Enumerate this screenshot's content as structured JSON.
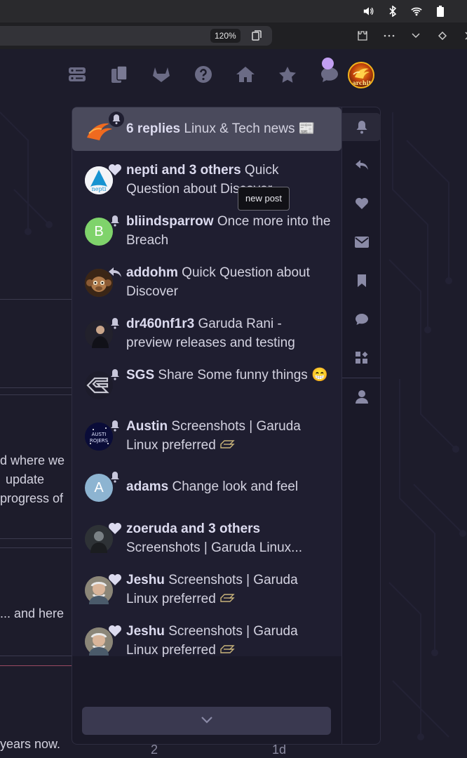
{
  "browser": {
    "zoom": "120%"
  },
  "header": {
    "icons": [
      "servers-icon",
      "documents-icon",
      "gitlab-icon",
      "help-icon",
      "home-icon",
      "star-icon",
      "chat-icon"
    ],
    "avatar_text": "archit"
  },
  "background": {
    "text1": "d where we",
    "text2": "update",
    "text3": "progress of",
    "text4": "... and here",
    "text5": "years now.",
    "text6": "2",
    "text7": "1d"
  },
  "tooltip": "new post",
  "notifications": [
    {
      "user": "6 replies",
      "topic": "Linux & Tech news 📰",
      "badge": "bell",
      "avatar": "archit",
      "active": true
    },
    {
      "user": "nepti and 3 others",
      "topic": "Quick Question about Discover",
      "badge": "heart",
      "avatar": "nepti"
    },
    {
      "user": "bliindsparrow",
      "topic": "Once more into the Breach",
      "badge": "bell",
      "avatar": "B"
    },
    {
      "user": "addohm",
      "topic": "Quick Question about Discover",
      "badge": "reply",
      "avatar": "monkey"
    },
    {
      "user": "dr460nf1r3",
      "topic": "Garuda Rani - preview releases and testing",
      "badge": "bell",
      "avatar": "person"
    },
    {
      "user": "SGS",
      "topic": "Share Some funny things 😁",
      "badge": "bell",
      "avatar": "sgs"
    },
    {
      "user": "Austin",
      "topic": "Screenshots | Garuda Linux preferred",
      "badge": "bell",
      "avatar": "austin"
    },
    {
      "user": "adams",
      "topic": "Change look and feel",
      "badge": "bell",
      "avatar": "A"
    },
    {
      "user": "zoeruda and 3 others",
      "topic": "Screenshots | Garuda Linux...",
      "badge": "heart",
      "avatar": "zoe"
    },
    {
      "user": "Jeshu",
      "topic": "Screenshots | Garuda Linux preferred",
      "badge": "heart",
      "avatar": "jeshu"
    },
    {
      "user": "Jeshu",
      "topic": "Screenshots | Garuda Linux preferred",
      "badge": "heart",
      "avatar": "jeshu"
    }
  ],
  "rail": [
    "bell-icon",
    "reply-icon",
    "heart-icon",
    "envelope-icon",
    "bookmark-icon",
    "chat-bubble-icon",
    "widgets-icon",
    "user-icon"
  ],
  "colors": {
    "accent": "#c29ff2",
    "active_row": "#4a4a5c",
    "green_avatar": "#7fd36b",
    "blue_avatar": "#8db4d1"
  }
}
